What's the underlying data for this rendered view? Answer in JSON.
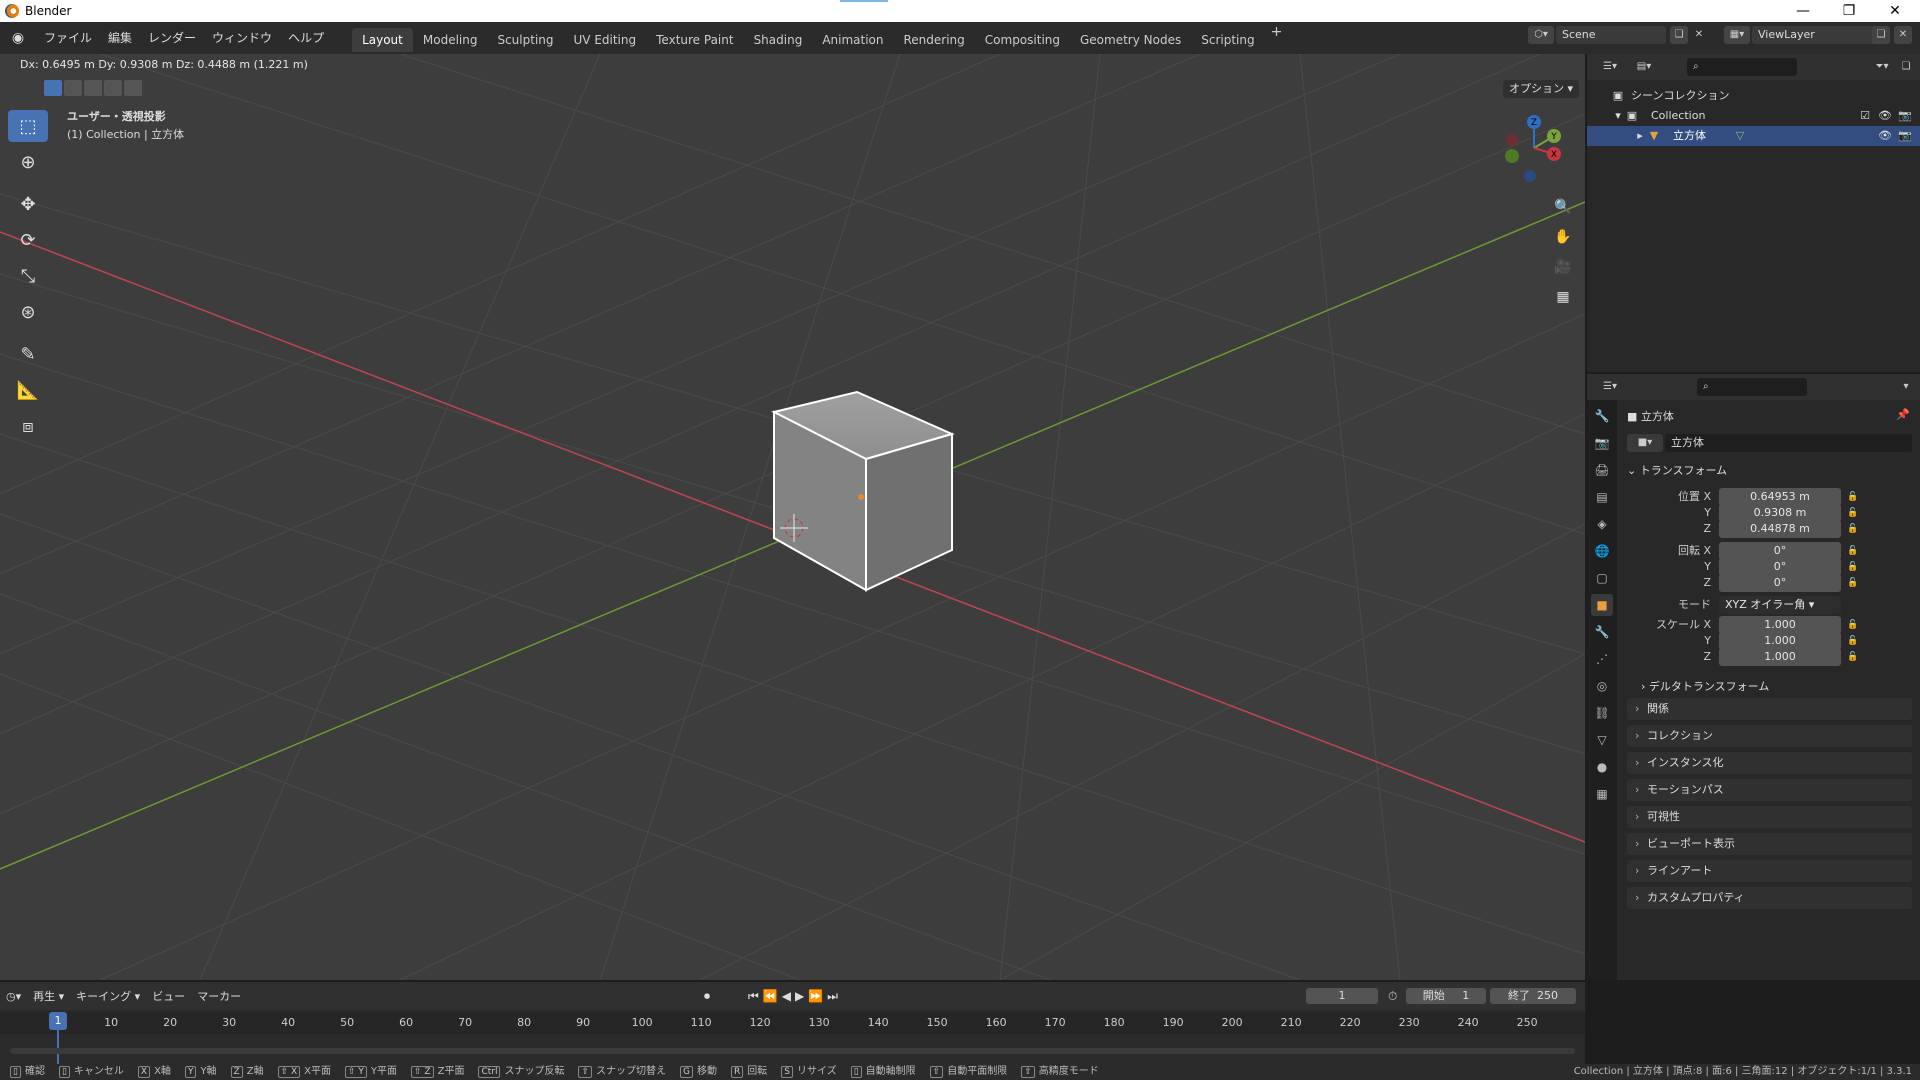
{
  "window": {
    "title": "Blender"
  },
  "menu": [
    "ファイル",
    "編集",
    "レンダー",
    "ウィンドウ",
    "ヘルプ"
  ],
  "workspaces": [
    "Layout",
    "Modeling",
    "Sculpting",
    "UV Editing",
    "Texture Paint",
    "Shading",
    "Animation",
    "Rendering",
    "Compositing",
    "Geometry Nodes",
    "Scripting"
  ],
  "active_workspace": "Layout",
  "scene": {
    "name": "Scene",
    "view_layer": "ViewLayer"
  },
  "viewport": {
    "header_text": "Dx: 0.6495 m   Dy: 0.9308 m   Dz: 0.4488 m (1.221 m)",
    "options": "オプション",
    "view_name": "ユーザー・透視投影",
    "collection_info": "(1) Collection | 立方体",
    "gizmo": {
      "x": "X",
      "y": "Y",
      "z": "Z"
    }
  },
  "outliner": {
    "scene_collection": "シーンコレクション",
    "collection": "Collection",
    "object": "立方体"
  },
  "properties": {
    "object_name": "立方体",
    "data_name": "立方体",
    "transform_title": "トランスフォーム",
    "location": {
      "label": "位置 X",
      "x": "0.64953 m",
      "y": "0.9308 m",
      "z": "0.44878 m"
    },
    "rotation": {
      "label": "回転 X",
      "x": "0°",
      "y": "0°",
      "z": "0°"
    },
    "mode_label": "モード",
    "mode_value": "XYZ オイラー角",
    "scale": {
      "label": "スケール X",
      "x": "1.000",
      "y": "1.000",
      "z": "1.000"
    },
    "y": "Y",
    "z": "Z",
    "delta": "デルタトランスフォーム",
    "sections": [
      "関係",
      "コレクション",
      "インスタンス化",
      "モーションパス",
      "可視性",
      "ビューポート表示",
      "ラインアート",
      "カスタムプロパティ"
    ]
  },
  "timeline": {
    "menus": [
      "再生",
      "キーイング",
      "ビュー",
      "マーカー"
    ],
    "current_frame": "1",
    "start_label": "開始",
    "start": "1",
    "end_label": "終了",
    "end": "250",
    "ticks": [
      "10",
      "20",
      "30",
      "40",
      "50",
      "60",
      "70",
      "80",
      "90",
      "100",
      "110",
      "120",
      "130",
      "140",
      "150",
      "160",
      "170",
      "180",
      "190",
      "200",
      "210",
      "220",
      "230",
      "240",
      "250"
    ],
    "cursor": "1"
  },
  "statusbar": {
    "items": [
      {
        "key": "",
        "label": "確認"
      },
      {
        "key": "",
        "label": "キャンセル"
      },
      {
        "key": "X",
        "label": "X軸"
      },
      {
        "key": "Y",
        "label": "Y軸"
      },
      {
        "key": "Z",
        "label": "Z軸"
      },
      {
        "key": "⇧ X",
        "label": "X平面"
      },
      {
        "key": "⇧ Y",
        "label": "Y平面"
      },
      {
        "key": "⇧ Z",
        "label": "Z平面"
      },
      {
        "key": "Ctrl",
        "label": "スナップ反転"
      },
      {
        "key": "⇧",
        "label": "スナップ切替え"
      },
      {
        "key": "G",
        "label": "移動"
      },
      {
        "key": "R",
        "label": "回転"
      },
      {
        "key": "S",
        "label": "リサイズ"
      },
      {
        "key": "",
        "label": "自動軸制限"
      },
      {
        "key": "⇧",
        "label": "自動平面制限"
      },
      {
        "key": "⇧",
        "label": "高精度モード"
      }
    ],
    "right": "Collection | 立方体 | 頂点:8 | 面:6 | 三角面:12 | オブジェクト:1/1 | 3.3.1"
  }
}
